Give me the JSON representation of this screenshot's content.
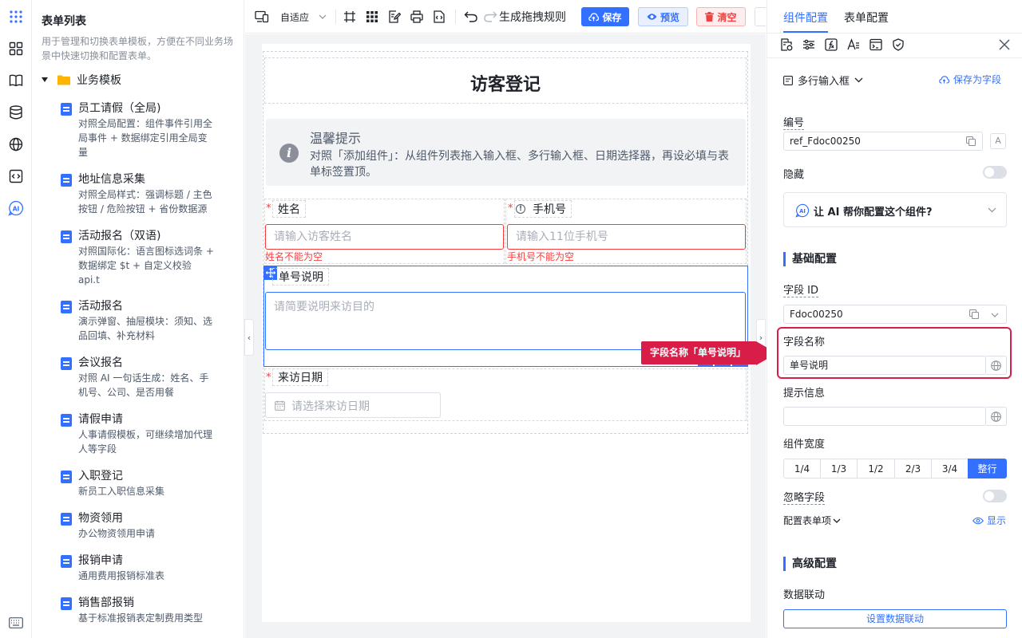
{
  "template_list": {
    "title": "表单列表",
    "description": "用于管理和切换表单模板，方便在不同业务场景中快速切换和配置表单。",
    "folder": "业务模板",
    "items": [
      {
        "name": "员工请假（全局)",
        "sub": "对照全局配置：组件事件引用全局事件 + 数据绑定引用全局变量"
      },
      {
        "name": "地址信息采集",
        "sub": "对照全局样式：强调标题 / 主色按钮 / 危险按钮 + 省份数据源"
      },
      {
        "name": "活动报名（双语)",
        "sub": "对照国际化：语言图标选词条 + 数据绑定 $t + 自定义校验 api.t"
      },
      {
        "name": "活动报名",
        "sub": "演示弹窗、抽屉模块：须知、选品回填、补充材料"
      },
      {
        "name": "会议报名",
        "sub": "对照 AI 一句话生成：姓名、手机号、公司、是否用餐"
      },
      {
        "name": "请假申请",
        "sub": "人事请假模板，可继续增加代理人等字段"
      },
      {
        "name": "入职登记",
        "sub": "新员工入职信息采集"
      },
      {
        "name": "物资领用",
        "sub": "办公物资领用申请"
      },
      {
        "name": "报销申请",
        "sub": "通用费用报销标准表"
      },
      {
        "name": "销售部报销",
        "sub": "基于标准报销表定制费用类型"
      }
    ]
  },
  "toolbar": {
    "device": "自适应",
    "generate_rules": "生成拖拽规则",
    "save": "保存",
    "preview": "预览",
    "clear": "清空"
  },
  "form": {
    "title": "访客登记",
    "tip_title": "温馨提示",
    "tip_text": "对照「添加组件」：从组件列表拖入输入框、多行输入框、日期选择器，再设必填与表单标签置顶。",
    "name_label": "姓名",
    "name_placeholder": "请输入访客姓名",
    "name_error": "姓名不能为空",
    "phone_label": "手机号",
    "phone_placeholder": "请输入11位手机号",
    "phone_error": "手机号不能为空",
    "note_label": "单号说明",
    "note_placeholder": "请简要说明来访目的",
    "date_label": "来访日期",
    "date_placeholder": "请选择来访日期"
  },
  "callout": "字段名称「单号说明」",
  "config": {
    "tab_component": "组件配置",
    "tab_form": "表单配置",
    "component_type": "多行输入框",
    "save_as_field": "保存为字段",
    "id_label": "编号",
    "id_value": "ref_Fdoc00250",
    "hidden_label": "隐藏",
    "ai_prompt": "让 AI 帮你配置这个组件?",
    "basic_section": "基础配置",
    "field_id_label": "字段 ID",
    "field_id_value": "Fdoc00250",
    "field_name_label": "字段名称",
    "field_name_value": "单号说明",
    "hint_label": "提示信息",
    "hint_value": "",
    "width_label": "组件宽度",
    "width_options": [
      "1/4",
      "1/3",
      "1/2",
      "2/3",
      "3/4",
      "整行"
    ],
    "width_selected": "整行",
    "ignore_label": "忽略字段",
    "form_items_label": "配置表单项",
    "show_label": "显示",
    "advanced_section": "高级配置",
    "linkage_label": "数据联动",
    "linkage_button": "设置数据联动"
  },
  "colors": {
    "primary": "#3370ff",
    "danger": "#f53f3f",
    "callout": "#d81e48"
  }
}
